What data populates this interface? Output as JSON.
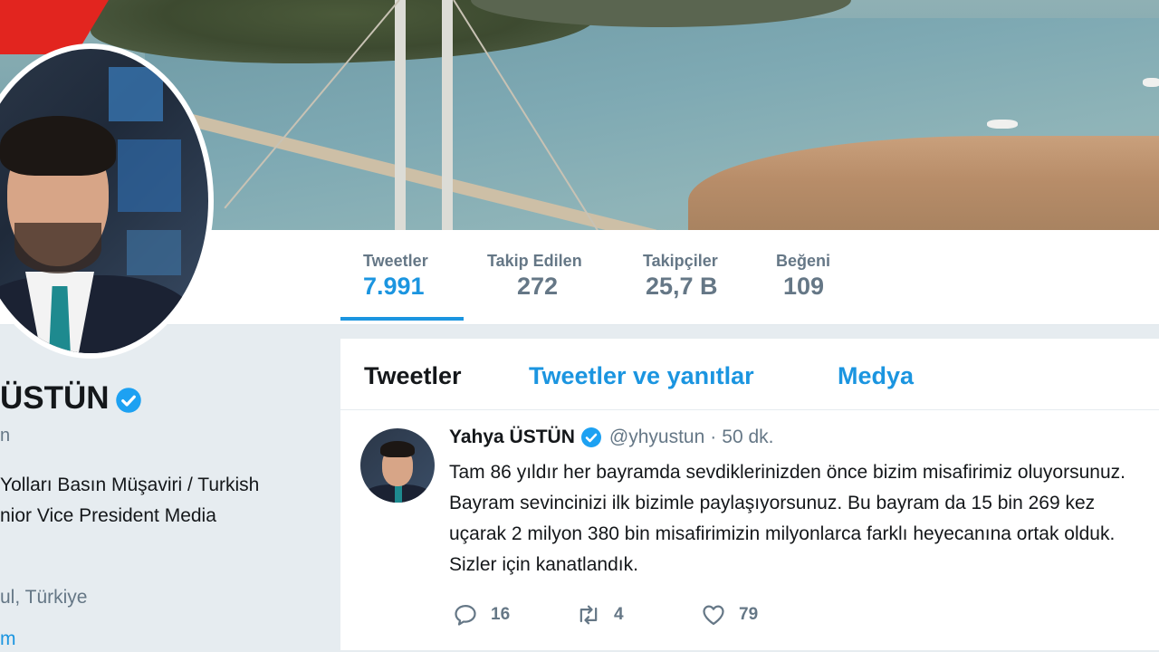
{
  "profile": {
    "name": "ÜSTÜN",
    "handle_fragment": "n",
    "bio_lines": [
      "Yolları Basın Müşaviri / Turkish",
      "nior Vice President Media"
    ],
    "location": "ul, Türkiye",
    "link_fragment": "m"
  },
  "stats": [
    {
      "label": "Tweetler",
      "value": "7.991"
    },
    {
      "label": "Takip Edilen",
      "value": "272"
    },
    {
      "label": "Takipçiler",
      "value": "25,7 B"
    },
    {
      "label": "Beğeni",
      "value": "109"
    }
  ],
  "tabs": [
    {
      "label": "Tweetler"
    },
    {
      "label": "Tweetler ve yanıtlar"
    },
    {
      "label": "Medya"
    }
  ],
  "tweet": {
    "author_name": "Yahya ÜSTÜN",
    "author_handle": "@yhyustun",
    "separator": "·",
    "time": "50 dk.",
    "text_lines": [
      "Tam 86 yıldır her bayramda sevdiklerinizden önce bizim misafirimiz oluyorsunuz.",
      "Bayram sevincinizi ilk bizimle paylaşıyorsunuz. Bu bayram da 15 bin 269 kez",
      "uçarak 2 milyon 380 bin misafirimizin milyonlarca farklı heyecanına ortak olduk.",
      "Sizler için kanatlandık."
    ],
    "replies": "16",
    "retweets": "4",
    "likes": "79"
  },
  "icons": {
    "verified": "verified-badge-icon",
    "reply": "reply-icon",
    "retweet": "retweet-icon",
    "like": "heart-icon"
  },
  "colors": {
    "accent": "#1b95e0",
    "background": "#e6ecf0",
    "muted": "#657786"
  }
}
